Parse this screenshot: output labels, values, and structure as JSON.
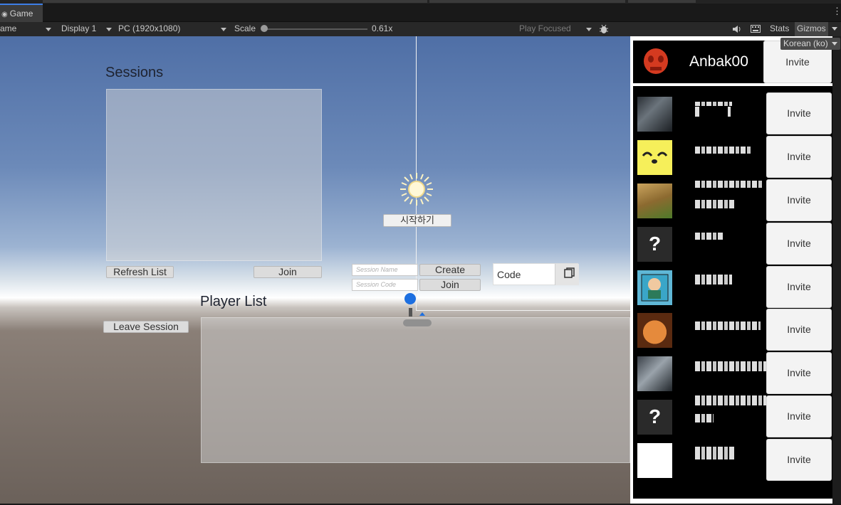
{
  "editor": {
    "tab_title": "Game",
    "toolbar": {
      "mode_label": "ame",
      "display_label": "Display 1",
      "resolution_label": "PC (1920x1080)",
      "scale_label": "Scale",
      "scale_value": "0.61x",
      "play_focused_label": "Play Focused",
      "stats_label": "Stats",
      "gizmos_label": "Gizmos"
    }
  },
  "game": {
    "sessions_title": "Sessions",
    "refresh_button": "Refresh List",
    "join_button": "Join",
    "session_name_placeholder": "Session Name",
    "session_code_placeholder": "Session Code",
    "create_button": "Create",
    "join_code_button": "Join",
    "start_button": "시작하기",
    "code_label": "Code",
    "player_list_title": "Player List",
    "leave_button": "Leave Session"
  },
  "friends_panel": {
    "language_dropdown": "Korean (ko)",
    "current_user": {
      "name": "Anbak00",
      "invite_label": "Invite"
    },
    "friends": [
      {
        "invite_label": "Invite"
      },
      {
        "invite_label": "Invite"
      },
      {
        "invite_label": "Invite"
      },
      {
        "invite_label": "Invite"
      },
      {
        "invite_label": "Invite"
      },
      {
        "invite_label": "Invite"
      },
      {
        "invite_label": "Invite"
      },
      {
        "invite_label": "Invite"
      },
      {
        "invite_label": "Invite"
      }
    ],
    "placeholder_avatar_glyph": "?"
  },
  "colors": {
    "accent": "#3d7ee6",
    "editor_bg": "#282828",
    "panel_black": "#000000"
  }
}
